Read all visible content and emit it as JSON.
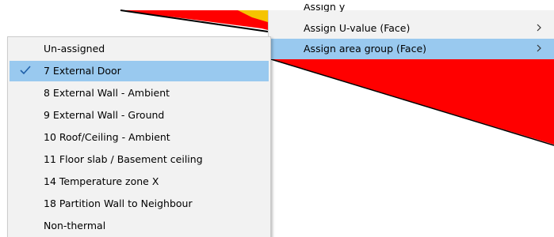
{
  "colors": {
    "menu_bg": "#f2f2f2",
    "highlight": "#99c9ef",
    "face_fill": "#ff0000",
    "hatch_fill": "#f5c400"
  },
  "parent_menu": {
    "partial_item_label": "Assign y",
    "items": [
      {
        "label": "Assign U-value (Face)",
        "has_submenu": true,
        "arrow_icon": "chevron-right-icon"
      },
      {
        "label": "Assign area group (Face)",
        "has_submenu": true,
        "arrow_icon": "chevron-right-icon",
        "highlighted": true
      }
    ]
  },
  "submenu": {
    "checked_icon": "checkmark-icon",
    "items": [
      {
        "label": "Un-assigned"
      },
      {
        "label": "7 External Door",
        "checked": true,
        "highlighted": true
      },
      {
        "label": "8 External Wall - Ambient"
      },
      {
        "label": "9 External Wall - Ground"
      },
      {
        "label": "10 Roof/Ceiling - Ambient"
      },
      {
        "label": "11 Floor slab / Basement ceiling"
      },
      {
        "label": "14 Temperature zone X"
      },
      {
        "label": "18 Partition Wall to Neighbour"
      },
      {
        "label": "Non-thermal"
      }
    ]
  }
}
